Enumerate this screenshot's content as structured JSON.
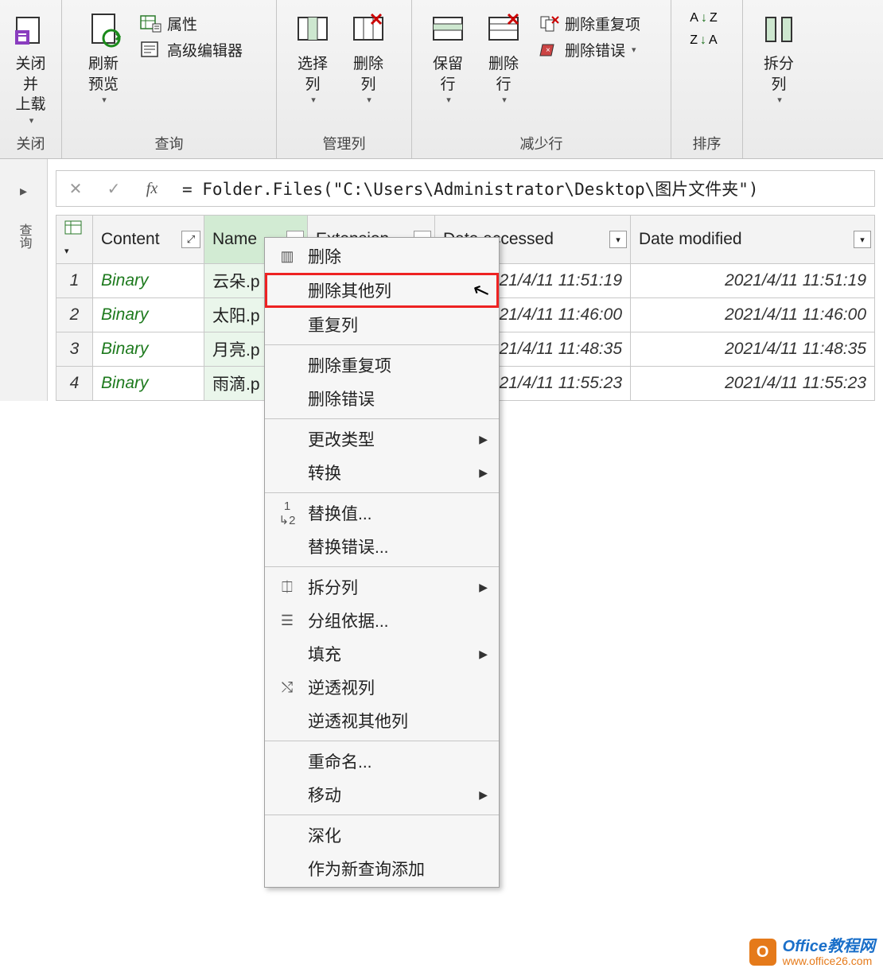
{
  "ribbon": {
    "groups": {
      "close": {
        "label": "关闭",
        "close_and_load": "关闭并\n上载"
      },
      "query": {
        "label": "查询",
        "refresh_preview": "刷新\n预览",
        "properties": "属性",
        "advanced_editor": "高级编辑器"
      },
      "manage_cols": {
        "label": "管理列",
        "select_cols": "选择\n列",
        "delete_cols": "删除\n列"
      },
      "reduce_rows": {
        "label": "减少行",
        "keep_rows": "保留\n行",
        "delete_rows": "删除\n行",
        "remove_duplicates": "删除重复项",
        "remove_errors": "删除错误"
      },
      "sort": {
        "label": "排序",
        "asc": "A↓Z",
        "desc": "Z↓A"
      },
      "split": {
        "label": "拆分\n列"
      }
    }
  },
  "formula_bar": {
    "text": "= Folder.Files(\"C:\\Users\\Administrator\\Desktop\\图片文件夹\")"
  },
  "side_panel": {
    "expand_glyph": "▸",
    "label": "查询"
  },
  "table": {
    "headers": {
      "content": "Content",
      "name": "Name",
      "extension": "Extension",
      "date_accessed": "Date accessed",
      "date_modified": "Date modified"
    },
    "rows": [
      {
        "n": "1",
        "content": "Binary",
        "name": "云朵.p",
        "date_accessed": "2021/4/11 11:51:19",
        "date_modified": "2021/4/11 11:51:19"
      },
      {
        "n": "2",
        "content": "Binary",
        "name": "太阳.p",
        "date_accessed": "2021/4/11 11:46:00",
        "date_modified": "2021/4/11 11:46:00"
      },
      {
        "n": "3",
        "content": "Binary",
        "name": "月亮.p",
        "date_accessed": "2021/4/11 11:48:35",
        "date_modified": "2021/4/11 11:48:35"
      },
      {
        "n": "4",
        "content": "Binary",
        "name": "雨滴.p",
        "date_accessed": "2021/4/11 11:55:23",
        "date_modified": "2021/4/11 11:55:23"
      }
    ]
  },
  "context_menu": {
    "items": {
      "delete": "删除",
      "delete_other_cols": "删除其他列",
      "duplicate_col": "重复列",
      "remove_duplicates": "删除重复项",
      "remove_errors": "删除错误",
      "change_type": "更改类型",
      "transform": "转换",
      "replace_values": "替换值...",
      "replace_errors": "替换错误...",
      "split_column": "拆分列",
      "group_by": "分组依据...",
      "fill": "填充",
      "unpivot": "逆透视列",
      "unpivot_other": "逆透视其他列",
      "rename": "重命名...",
      "move": "移动",
      "drill_down": "深化",
      "add_as_query": "作为新查询添加"
    }
  },
  "watermark": {
    "title": "Office教程网",
    "url": "www.office26.com",
    "badge": "O"
  }
}
